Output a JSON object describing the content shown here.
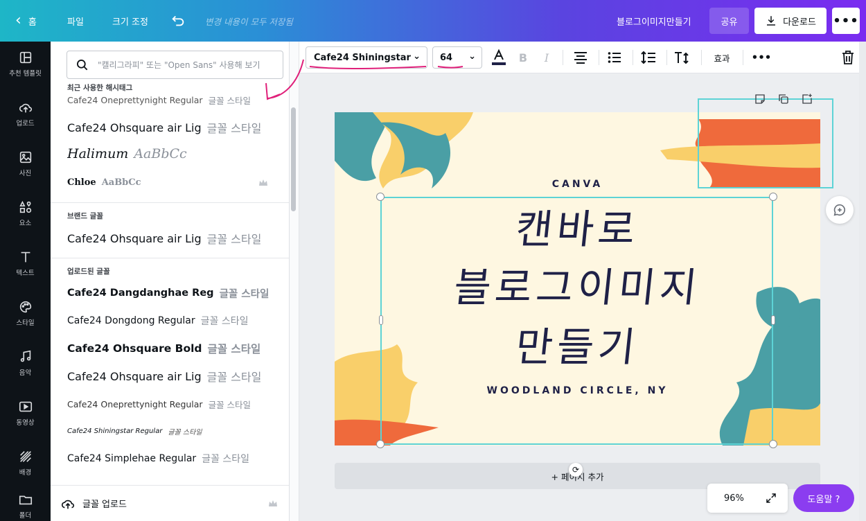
{
  "topbar": {
    "home_label": "홈",
    "file_label": "파일",
    "resize_label": "크기 조정",
    "save_status": "변경 내용이 모두 저장됨",
    "doc_title": "블로그이미지만들기",
    "share_label": "공유",
    "download_label": "다운로드"
  },
  "rail": {
    "items": [
      {
        "label": "추천 템플릿",
        "icon": "template-icon"
      },
      {
        "label": "업로드",
        "icon": "upload-cloud-icon"
      },
      {
        "label": "사진",
        "icon": "photo-icon"
      },
      {
        "label": "요소",
        "icon": "elements-icon"
      },
      {
        "label": "텍스트",
        "icon": "text-icon"
      },
      {
        "label": "스타일",
        "icon": "palette-icon"
      },
      {
        "label": "음악",
        "icon": "music-icon"
      },
      {
        "label": "동영상",
        "icon": "video-icon"
      },
      {
        "label": "배경",
        "icon": "background-icon"
      },
      {
        "label": "폴더",
        "icon": "folder-icon"
      }
    ]
  },
  "font_panel": {
    "search_placeholder": "\"캘리그라피\" 또는 \"Open Sans\" 사용해 보기",
    "recent_heading": "최근 사용한 해시태그",
    "recent_fonts": [
      {
        "name": "Cafe24 Oneprettynight Regular",
        "sample": "글꼴 스타일"
      },
      {
        "name": "Cafe24 Ohsquare air Lig",
        "sample": "글꼴 스타일"
      },
      {
        "name": "Halimum",
        "sample": "AaBbCc"
      },
      {
        "name": "Chloe",
        "sample": "AaBbCc"
      }
    ],
    "brand_heading": "브랜드 글꼴",
    "brand_fonts": [
      {
        "name": "Cafe24 Ohsquare air Lig",
        "sample": "글꼴 스타일"
      }
    ],
    "uploaded_heading": "업로드된 글꼴",
    "uploaded_fonts": [
      {
        "name": "Cafe24 Dangdanghae Reg",
        "sample": "글꼴 스타일"
      },
      {
        "name": "Cafe24 Dongdong Regular",
        "sample": "글꼴 스타일"
      },
      {
        "name": "Cafe24 Ohsquare Bold",
        "sample": "글꼴 스타일"
      },
      {
        "name": "Cafe24 Ohsquare air Lig",
        "sample": "글꼴 스타일"
      },
      {
        "name": "Cafe24 Oneprettynight Regular",
        "sample": "글꼴 스타일"
      },
      {
        "name": "Cafe24 Shiningstar Regular",
        "sample": "글꼴 스타일"
      },
      {
        "name": "Cafe24 Simplehae Regular",
        "sample": "글꼴 스타일"
      }
    ],
    "upload_label": "글꼴 업로드"
  },
  "toolbar": {
    "font_name": "Cafe24 Shiningstar",
    "font_size": "64",
    "bold_label": "B",
    "italic_label": "I",
    "effects_label": "효과"
  },
  "canvas": {
    "brand": "CANVA",
    "title_lines": [
      "캔바로",
      "블로그이미지",
      "만들기"
    ],
    "subtitle": "WOODLAND CIRCLE, NY",
    "add_page_label": "+ 페이지 추가",
    "zoom": "96%",
    "help_label": "도움말 ?"
  },
  "colors": {
    "accent_purple": "#8b3df0",
    "selection": "#5dd3d6",
    "annotation": "#e0207a",
    "teal": "#4a9fa5",
    "orange": "#ef6a3c",
    "yellow": "#f9cf6a",
    "text_navy": "#1f2147"
  }
}
